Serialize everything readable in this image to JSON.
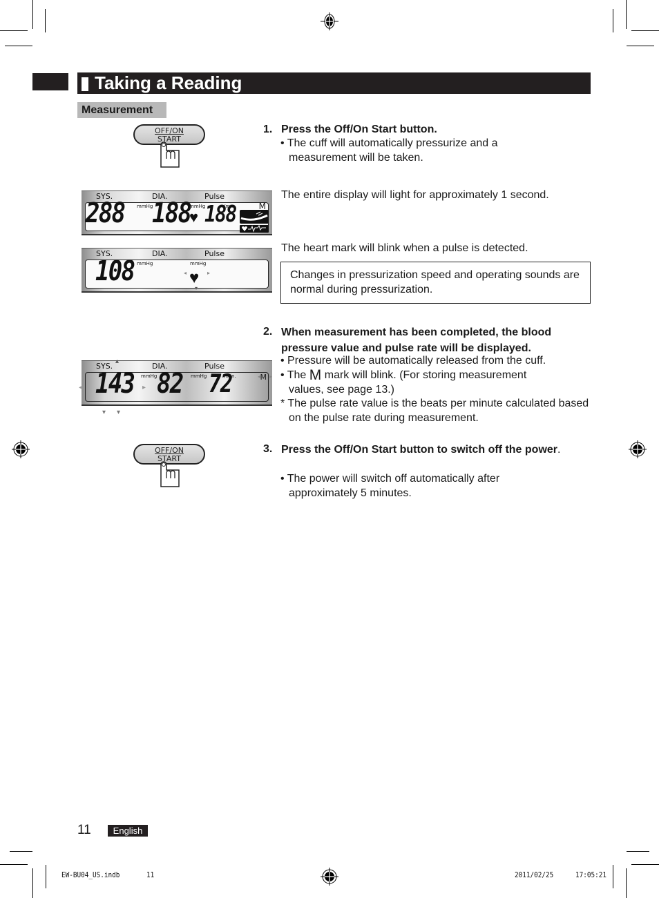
{
  "header": {
    "title": "Taking a Reading",
    "section": "Measurement"
  },
  "button_illustration": {
    "line1": "OFF/ON",
    "line2": "START"
  },
  "lcd_labels": {
    "sys": "SYS.",
    "dia": "DIA.",
    "pulse": "Pulse",
    "unit_mmhg": "mmHg",
    "unit_min": "/min.",
    "memory": "M"
  },
  "lcd_all_on": {
    "sys": "288",
    "dia": "188",
    "pulse": "188"
  },
  "lcd_pressurizing": {
    "sys": "108"
  },
  "lcd_result": {
    "sys": "143",
    "dia": "82",
    "pulse": "72"
  },
  "steps": [
    {
      "number": "1.",
      "heading": "Press the Off/On Start button.",
      "bullets": [
        "• The cuff will automatically pressurize and a measurement will be taken."
      ]
    },
    {
      "number": "2.",
      "heading": "When measurement has been completed, the blood pressure value and pulse rate will be displayed.",
      "bullets": [
        "• Pressure will be automatically released from the cuff.",
        "• The",
        "mark will blink. (For storing measurement values, see page 13.)",
        "* The pulse rate value is the beats per minute calculated based on the pulse rate during measurement."
      ]
    },
    {
      "number": "3.",
      "heading": "Press the Off/On Start button to switch off the power",
      "heading_suffix": ".",
      "bullets": [
        "• The power will switch off automatically after approximately 5 minutes."
      ]
    }
  ],
  "notes": {
    "display_light": "The entire display will light for approximately 1 second.",
    "heart_blink": "The heart mark will blink when a pulse is detected.",
    "box": "Changes in pressurization speed and operating sounds are normal during pressurization."
  },
  "footer": {
    "page_number": "11",
    "language": "English",
    "file": "EW-BU04_US.indb",
    "file_page": "11",
    "date": "2011/02/25",
    "time": "17:05:21"
  }
}
